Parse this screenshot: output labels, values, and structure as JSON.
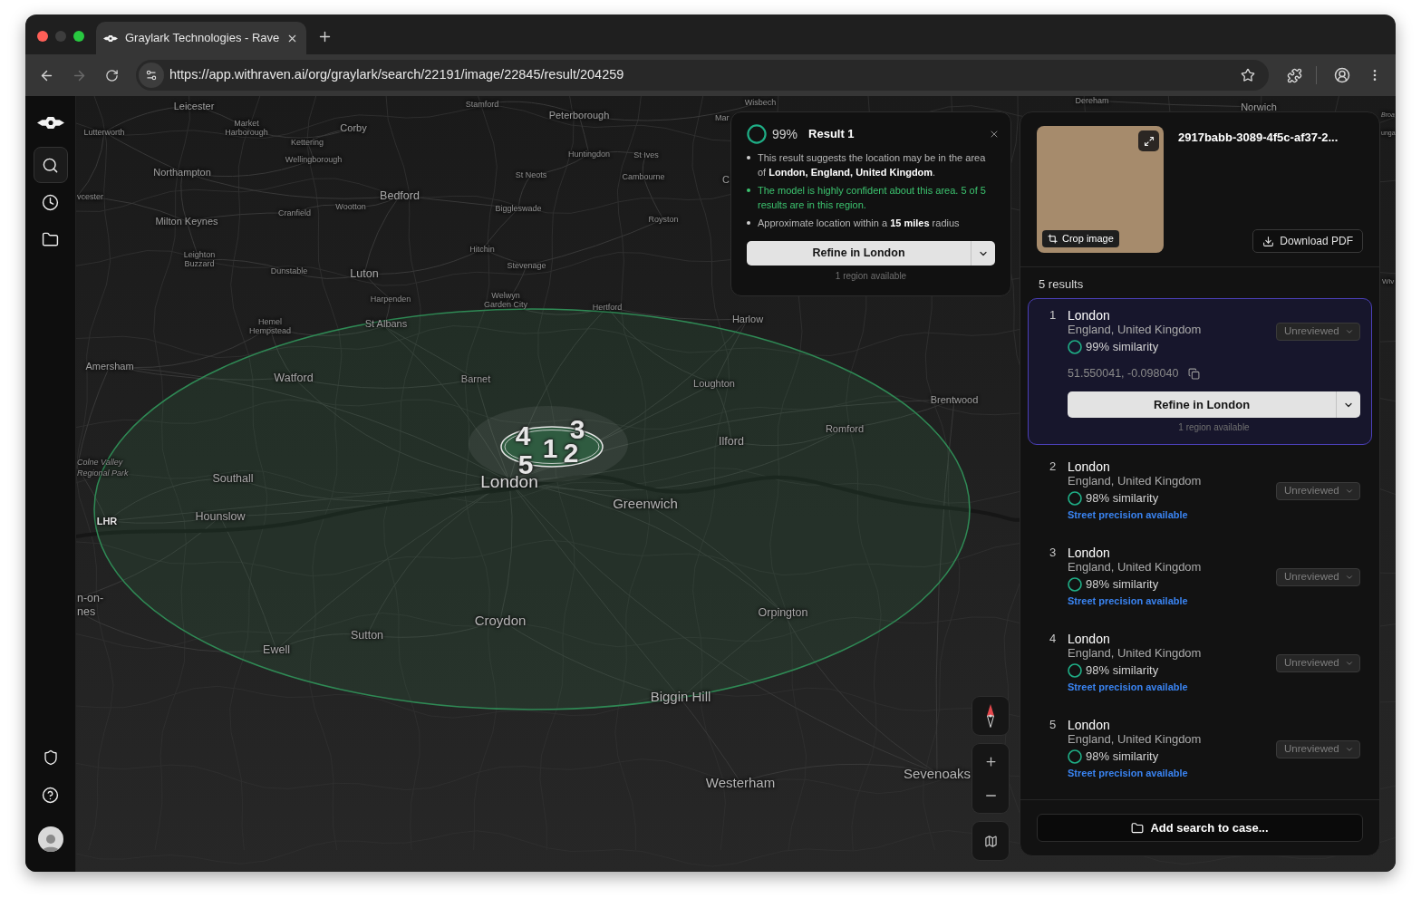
{
  "window": {
    "minimize_disabled": true
  },
  "browser": {
    "tab": {
      "title": "Graylark Technologies - Rave"
    },
    "forward_disabled": true,
    "url": "https://app.withraven.ai/org/graylark/search/22191/image/22845/result/204259"
  },
  "sidebar": {
    "items": [
      {
        "selected": true
      },
      {
        "selected": false
      },
      {
        "selected": false
      }
    ]
  },
  "map": {
    "labels": [
      "Leicester",
      "Stamford",
      "Wisbech",
      "Dereham",
      "Norwich",
      "Peterborough",
      "Mar",
      "Broa",
      "Lutterworth",
      "Market Harborough",
      "Corby",
      "unga",
      "Kettering",
      "Wellingborough",
      "Huntingdon",
      "St Ives",
      "Northampton",
      "St Neots",
      "Cambourne",
      "C",
      "vcester",
      "Bedford",
      "Milton Keynes",
      "Cranfield",
      "Wootton",
      "Biggleswade",
      "Royston",
      "Leighton Buzzard",
      "Dunstable",
      "Luton",
      "Hitchin",
      "Stevenage",
      "Wiv",
      "Harpenden",
      "Welwyn Garden City",
      "Hertford",
      "Hemel Hempstead",
      "St Albans",
      "Harlow",
      "Amersham",
      "Watford",
      "Barnet",
      "Loughton",
      "Brentwood",
      "Romford",
      "Ilford",
      "Colne Valley Regional Park",
      "Southall",
      "London",
      "Greenwich",
      "LHR",
      "Hounslow",
      "n-on-",
      "nes",
      "Croydon",
      "Orpington",
      "Sutton",
      "Ewell",
      "Biggin Hill",
      "Westerham",
      "Sevenoaks"
    ],
    "markers": [
      "4",
      "3",
      "1",
      "2",
      "5"
    ]
  },
  "result_popup": {
    "similarity": "99%",
    "title": "Result 1",
    "bullets": [
      {
        "text": "This result suggests the location may be in the area of **London, England, United Kingdom**.",
        "highlight": false
      },
      {
        "text": "The model is highly confident about this area. 5 of 5 results are in this region.",
        "highlight": true
      },
      {
        "text": "Approximate location within a **15 miles** radius",
        "highlight": false
      }
    ],
    "refine_button": "Refine in London",
    "note": "1 region available"
  },
  "results_panel": {
    "crop_button": "Crop image",
    "title": "2917babb-3089-4f5c-af37-2...",
    "download_button": "Download PDF",
    "count": "5 results",
    "results": [
      {
        "rank": "1",
        "name": "London",
        "region": "England, United Kingdom",
        "similarity": "99% similarity",
        "status": "Unreviewed",
        "selected": true,
        "coordinates": "51.550041, -0.098040",
        "refine_button": "Refine in London",
        "refine_note": "1 region available"
      },
      {
        "rank": "2",
        "name": "London",
        "region": "England, United Kingdom",
        "similarity": "98% similarity",
        "status": "Unreviewed",
        "selected": false,
        "precision": "Street precision available"
      },
      {
        "rank": "3",
        "name": "London",
        "region": "England, United Kingdom",
        "similarity": "98% similarity",
        "status": "Unreviewed",
        "selected": false,
        "precision": "Street precision available"
      },
      {
        "rank": "4",
        "name": "London",
        "region": "England, United Kingdom",
        "similarity": "98% similarity",
        "status": "Unreviewed",
        "selected": false,
        "precision": "Street precision available"
      },
      {
        "rank": "5",
        "name": "London",
        "region": "England, United Kingdom",
        "similarity": "98% similarity",
        "status": "Unreviewed",
        "selected": false,
        "precision": "Street precision available"
      }
    ],
    "add_button": "Add search to case..."
  }
}
